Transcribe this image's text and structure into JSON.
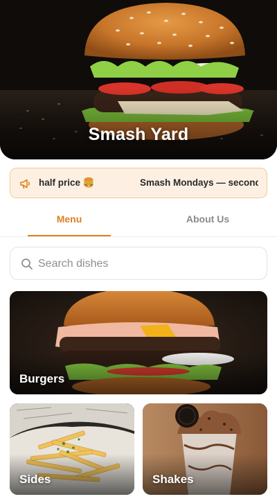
{
  "hero": {
    "title": "Smash Yard",
    "image": "burger-photo"
  },
  "promo": {
    "icon": "megaphone-icon",
    "segment_a": "half price 🍔",
    "segment_b": "Smash Mondays — second b"
  },
  "tabs": [
    {
      "label": "Menu",
      "active": true
    },
    {
      "label": "About Us",
      "active": false
    }
  ],
  "search": {
    "icon": "search-icon",
    "placeholder": "Search dishes",
    "value": ""
  },
  "categories": [
    {
      "label": "Burgers",
      "image": "burger-photo"
    },
    {
      "label": "Sides",
      "image": "fries-photo"
    },
    {
      "label": "Shakes",
      "image": "milkshake-photo"
    }
  ],
  "colors": {
    "accent": "#e07f1c",
    "promo_bg": "#fdf0e3",
    "promo_border": "#f2c89c",
    "inactive_tab": "#8a8a8a"
  }
}
